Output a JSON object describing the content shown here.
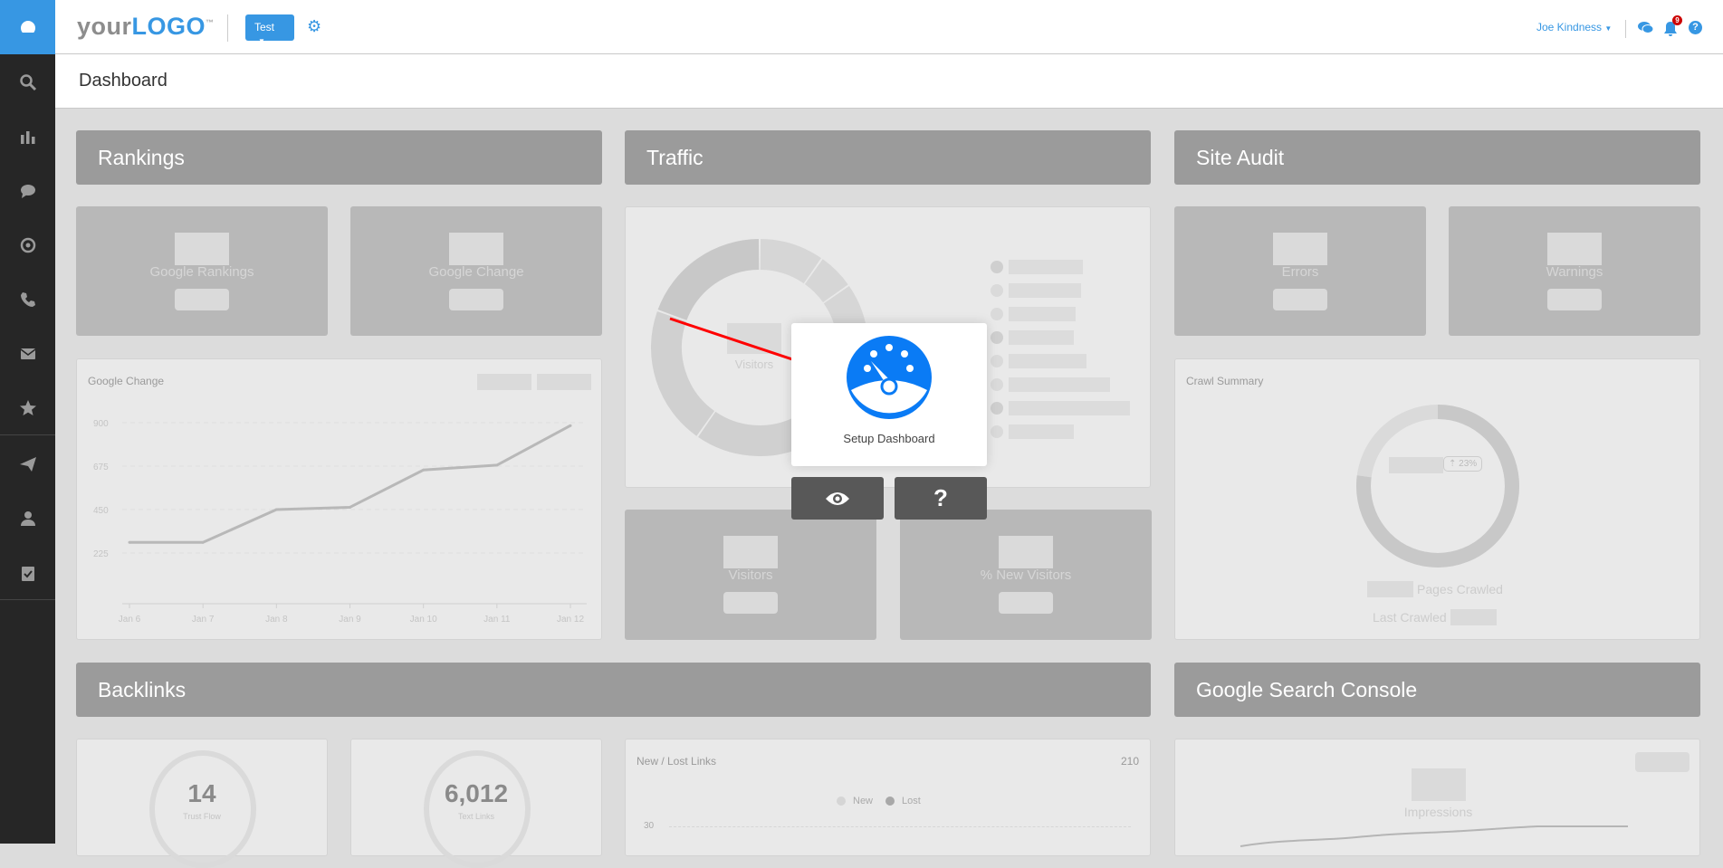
{
  "sidebar": {
    "items": [
      {
        "icon": "dashboard-icon",
        "active": true
      },
      {
        "icon": "search-icon"
      },
      {
        "icon": "bar-chart-icon"
      },
      {
        "icon": "comment-icon"
      },
      {
        "icon": "at-sign-icon"
      },
      {
        "icon": "phone-icon"
      },
      {
        "icon": "envelope-icon"
      },
      {
        "icon": "star-icon"
      },
      {
        "icon": "paper-plane-icon"
      },
      {
        "icon": "user-icon"
      },
      {
        "icon": "clipboard-check-icon"
      }
    ]
  },
  "header": {
    "logo_light": "your",
    "logo_bold": "LOGO",
    "logo_tm": "™",
    "project_button": "Test",
    "user_name": "Joe Kindness",
    "notification_count": "9",
    "accent": "#3797e3"
  },
  "page_title": "Dashboard",
  "sections": {
    "rankings": "Rankings",
    "traffic": "Traffic",
    "site_audit": "Site Audit",
    "backlinks": "Backlinks",
    "gsc": "Google Search Console"
  },
  "rankings": {
    "card1": "Google Rankings",
    "card2": "Google Change"
  },
  "traffic": {
    "donut_label": "Visitors",
    "card1": "Visitors",
    "card2": "% New Visitors"
  },
  "site_audit": {
    "card1": "Errors",
    "card2": "Warnings",
    "crawl_title": "Crawl Summary",
    "crawl_badge": "23%",
    "pages_crawled": "Pages Crawled",
    "last_crawled": "Last Crawled"
  },
  "backlinks": {
    "trust_flow_value": "14",
    "trust_flow_label": "Trust Flow",
    "text_links_value": "6,012",
    "text_links_label": "Text Links",
    "new_lost_title": "New / Lost Links",
    "new_lost_total": "210",
    "legend_new": "New",
    "legend_lost": "Lost",
    "y_tick": "30"
  },
  "gsc": {
    "impressions": "Impressions"
  },
  "modal": {
    "title": "Setup Dashboard",
    "preview_icon": "eye-icon",
    "help_icon": "question-icon"
  },
  "chart_data": {
    "type": "line",
    "title": "Google Change",
    "categories": [
      "Jan 6",
      "Jan 7",
      "Jan 8",
      "Jan 9",
      "Jan 10",
      "Jan 11",
      "Jan 12"
    ],
    "values": [
      280,
      280,
      450,
      462,
      655,
      680,
      885
    ],
    "yticks": [
      225,
      450,
      675,
      900
    ],
    "ylim": [
      0,
      900
    ],
    "grid": true
  }
}
